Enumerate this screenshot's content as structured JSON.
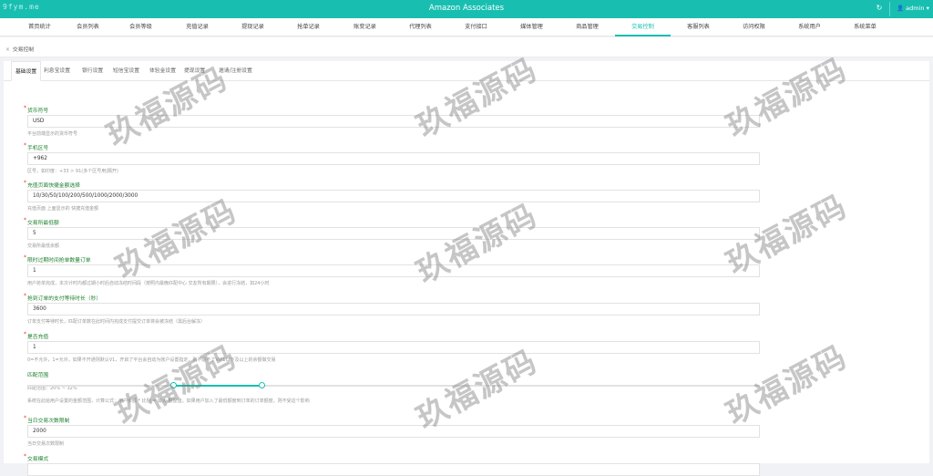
{
  "topbar": {
    "watermark": "9fym.me",
    "title": "Amazon Associates",
    "refresh_icon": "↻",
    "user_label": "👤 admin ▾"
  },
  "nav": {
    "items": [
      "首页统计",
      "会员列表",
      "会员等级",
      "充值记录",
      "提现记录",
      "抢单记录",
      "账变记录",
      "代理列表",
      "支付接口",
      "媒体管理",
      "商品管理",
      "交易控制",
      "客服列表",
      "访问权限",
      "系统用户",
      "系统菜单"
    ],
    "active_index": 11
  },
  "breadcrumb": {
    "close": "×",
    "label": "交易控制"
  },
  "subtabs": {
    "items": [
      "基础设置",
      "利息宝设置",
      "银行设置",
      "短信宝设置",
      "体验金设置",
      "提现设置",
      "邀请/注册设置"
    ],
    "active_index": 0
  },
  "form": {
    "fields": [
      {
        "label": "货币符号",
        "value": "USD",
        "hint": "平台前端显示的货币符号"
      },
      {
        "label": "手机区号",
        "value": "+962",
        "hint": "区号，如印度：+33 > 91(多个区号用|隔开)"
      },
      {
        "label": "充值页面快捷金额选择",
        "value": "10/30/50/100/200/500/1000/2000/3000",
        "hint": "充值页面 上面显示的 快捷充值金额"
      },
      {
        "label": "交易所最低额",
        "value": "5",
        "hint": "交易所最低余额"
      },
      {
        "label": "限时过期时间抢单数量订单",
        "value": "1",
        "hint": "用户抢单完成，本次计时内都过期小时后自动冻结时间段（按照内最晚匹配中心 交友所有期限），会进行冻结，如24小时"
      },
      {
        "label": "抢到订单的支付等待时长（秒）",
        "value": "3600",
        "hint": "订单支付等待时长，匹配订单数在此时间内完成支付提交订单将会被冻结（需后台解冻）"
      },
      {
        "label": "是否充值",
        "value": "1",
        "hint": "0=不允许，1=允许，如果不开通则默认V1，开启了平台会自动为账户设置指定，则不能不了VIP1以下及以上的余额做交易"
      },
      {
        "label": "匹配范围",
        "value": "",
        "hint": "匹配范围：20% ~ 32%"
      },
      {
        "label": "当日交易次数限制",
        "value": "2000",
        "hint": "当日交易次数限制"
      },
      {
        "label": "交易模式",
        "value": "",
        "hint": ""
      }
    ],
    "match_range_note": "系统在此给用户设置的金额范围，计算公式：用户余额 * 比例 = 最大 额度值，如果用户加入了最低额度到订单的订单额度，则不受这个影响",
    "slider": {
      "min_percent": 20,
      "max_percent": 32
    }
  },
  "watermark_text": "玖福源码",
  "colors": {
    "accent": "#18bfb0",
    "label": "#1a7f2c"
  }
}
